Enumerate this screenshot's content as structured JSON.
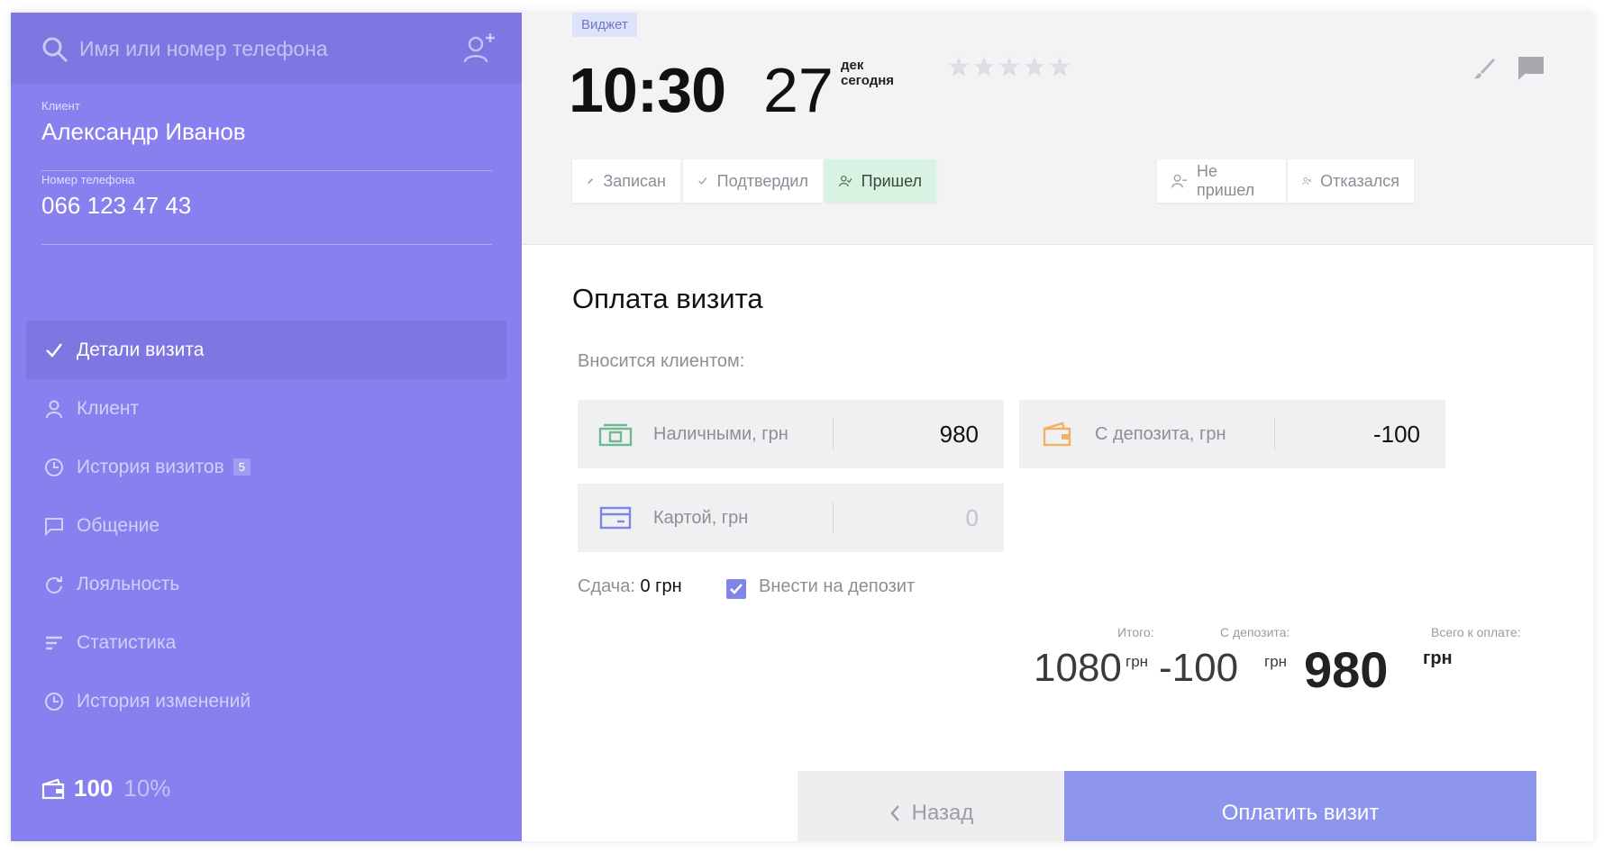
{
  "search": {
    "placeholder": "Имя или номер телефона",
    "icon": "search-icon",
    "add_icon": "add-user-icon"
  },
  "client": {
    "label": "Клиент",
    "name": "Александр Иванов"
  },
  "phone": {
    "label": "Номер телефона",
    "value": "066 123 47 43"
  },
  "nav": {
    "items": [
      {
        "label": "Детали визита",
        "icon": "check-icon",
        "active": true
      },
      {
        "label": "Клиент",
        "icon": "user-icon"
      },
      {
        "label": "История визитов",
        "icon": "clock-icon",
        "badge": "5"
      },
      {
        "label": "Общение",
        "icon": "chat-icon"
      },
      {
        "label": "Лояльность",
        "icon": "refresh-icon"
      },
      {
        "label": "Статистика",
        "icon": "bars-icon"
      },
      {
        "label": "История изменений",
        "icon": "clock-icon"
      }
    ]
  },
  "deposit": {
    "value": "100",
    "percent": "10%"
  },
  "header": {
    "widget_tag": "Виджет",
    "time": "10:30",
    "day": "27",
    "month": "дек",
    "relative": "сегодня",
    "rating": 0,
    "rating_max": 5
  },
  "statuses": {
    "booked": "Записан",
    "confirmed": "Подтвердил",
    "arrived": "Пришел",
    "no_show": "Не пришел",
    "cancelled": "Отказался",
    "active": "arrived"
  },
  "payment": {
    "title": "Оплата визита",
    "paid_by_label": "Вносится клиентом:",
    "cash_label": "Наличными, грн",
    "cash_value": "980",
    "deposit_label": "С депозита, грн",
    "deposit_value": "-100",
    "card_label": "Картой, грн",
    "card_value": "0",
    "change_label": "Сдача:",
    "change_value": "0 грн",
    "deposit_checkbox_label": "Внести на депозит",
    "deposit_checkbox_checked": true
  },
  "totals": {
    "subtotal_label": "Итого:",
    "subtotal_value": "1080",
    "from_deposit_label": "С депозита:",
    "from_deposit_value": "-100",
    "grand_label": "Всего к оплате:",
    "grand_value": "980",
    "currency": "грн"
  },
  "actions": {
    "back": "Назад",
    "pay": "Оплатить визит"
  },
  "colors": {
    "sidebar": "#8880ef",
    "primary_button": "#8d95ec",
    "arrived": "#d8f3e1"
  }
}
